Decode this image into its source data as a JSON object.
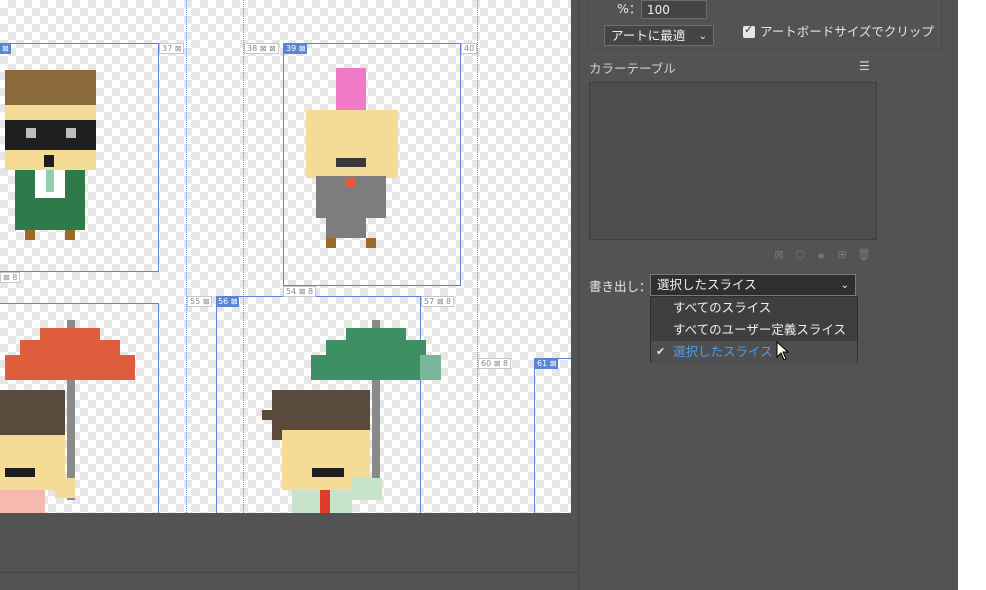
{
  "panel": {
    "percent_label": "%：",
    "percent_value": "100",
    "fit_select": "アートに最適",
    "clip_checkbox": {
      "checked": true,
      "label": "アートボードサイズでクリップ"
    },
    "color_table_title": "カラーテーブル",
    "export_label": "書き出し：",
    "export_select": "選択したスライス",
    "export_options": [
      {
        "label": "すべてのスライス",
        "selected": false
      },
      {
        "label": "すべてのユーザー定義スライス",
        "selected": false
      },
      {
        "label": "選択したスライス",
        "selected": true
      }
    ],
    "toolbar_icons": [
      "map-icon",
      "cube-icon",
      "lock-icon",
      "add-icon",
      "trash-icon"
    ]
  },
  "slices": {
    "s37": "37",
    "s38": "38",
    "s39": "39",
    "s40": "40",
    "s54": "54",
    "s55": "55",
    "s56": "56",
    "s57": "57",
    "s60": "60",
    "s61": "61"
  },
  "colors": {
    "slice_selected": "#5b84d6",
    "umbrella_red": "#dd5d3c",
    "umbrella_green": "#3e8f63",
    "mohawk_pink": "#f07ac8",
    "skin": "#f5dc96",
    "hair_brown": "#8a6a3a",
    "suit_green": "#2f7a4b",
    "suit_grey": "#8a8a8a",
    "panel_bg": "#535353"
  }
}
